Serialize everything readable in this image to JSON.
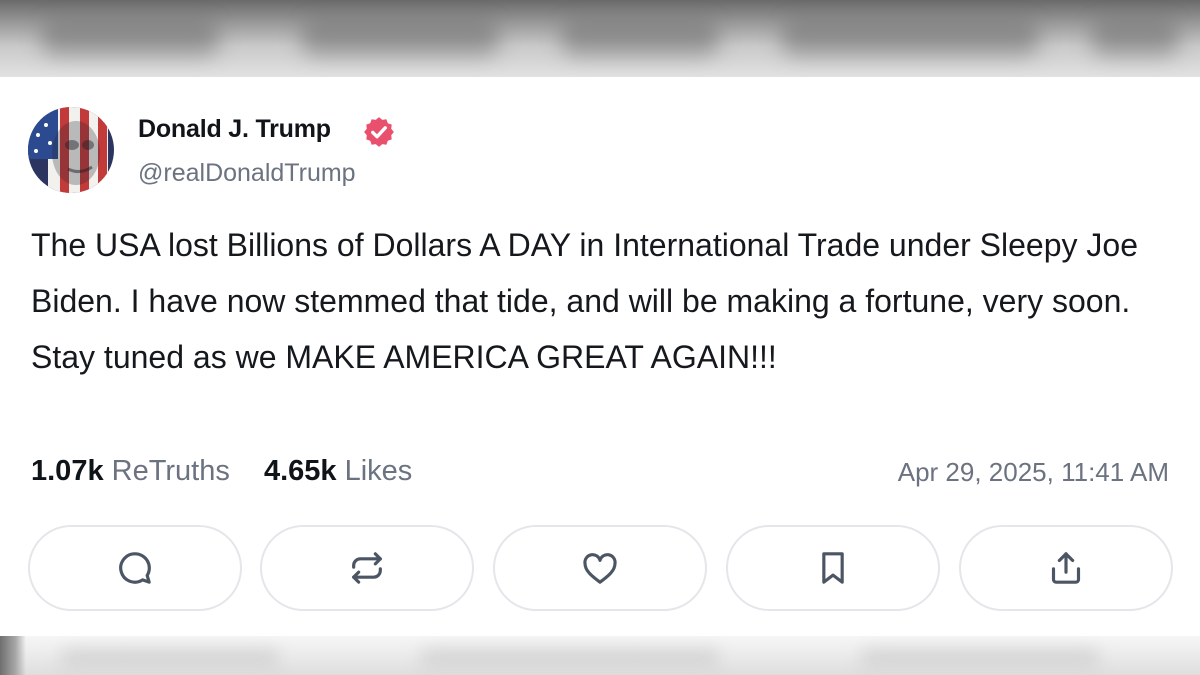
{
  "post": {
    "author_name": "Donald J. Trump",
    "handle": "@realDonaldTrump",
    "verified": true,
    "text": "The USA lost Billions of Dollars A DAY in International Trade under Sleepy Joe Biden. I have now stemmed that tide, and will be making a fortune, very soon. Stay tuned as we MAKE AMERICA GREAT AGAIN!!!",
    "retruths_count": "1.07k",
    "retruths_label": "ReTruths",
    "likes_count": "4.65k",
    "likes_label": "Likes",
    "timestamp": "Apr 29, 2025, 11:41 AM"
  },
  "actions": [
    {
      "icon": "comment-icon"
    },
    {
      "icon": "retruth-icon"
    },
    {
      "icon": "heart-icon"
    },
    {
      "icon": "bookmark-icon"
    },
    {
      "icon": "share-icon"
    }
  ],
  "colors": {
    "verified_badge": "#e8506e",
    "text_primary": "#0f1419",
    "text_secondary": "#6b7280",
    "button_border": "#e4e6ea",
    "icon_stroke": "#4b5563"
  }
}
